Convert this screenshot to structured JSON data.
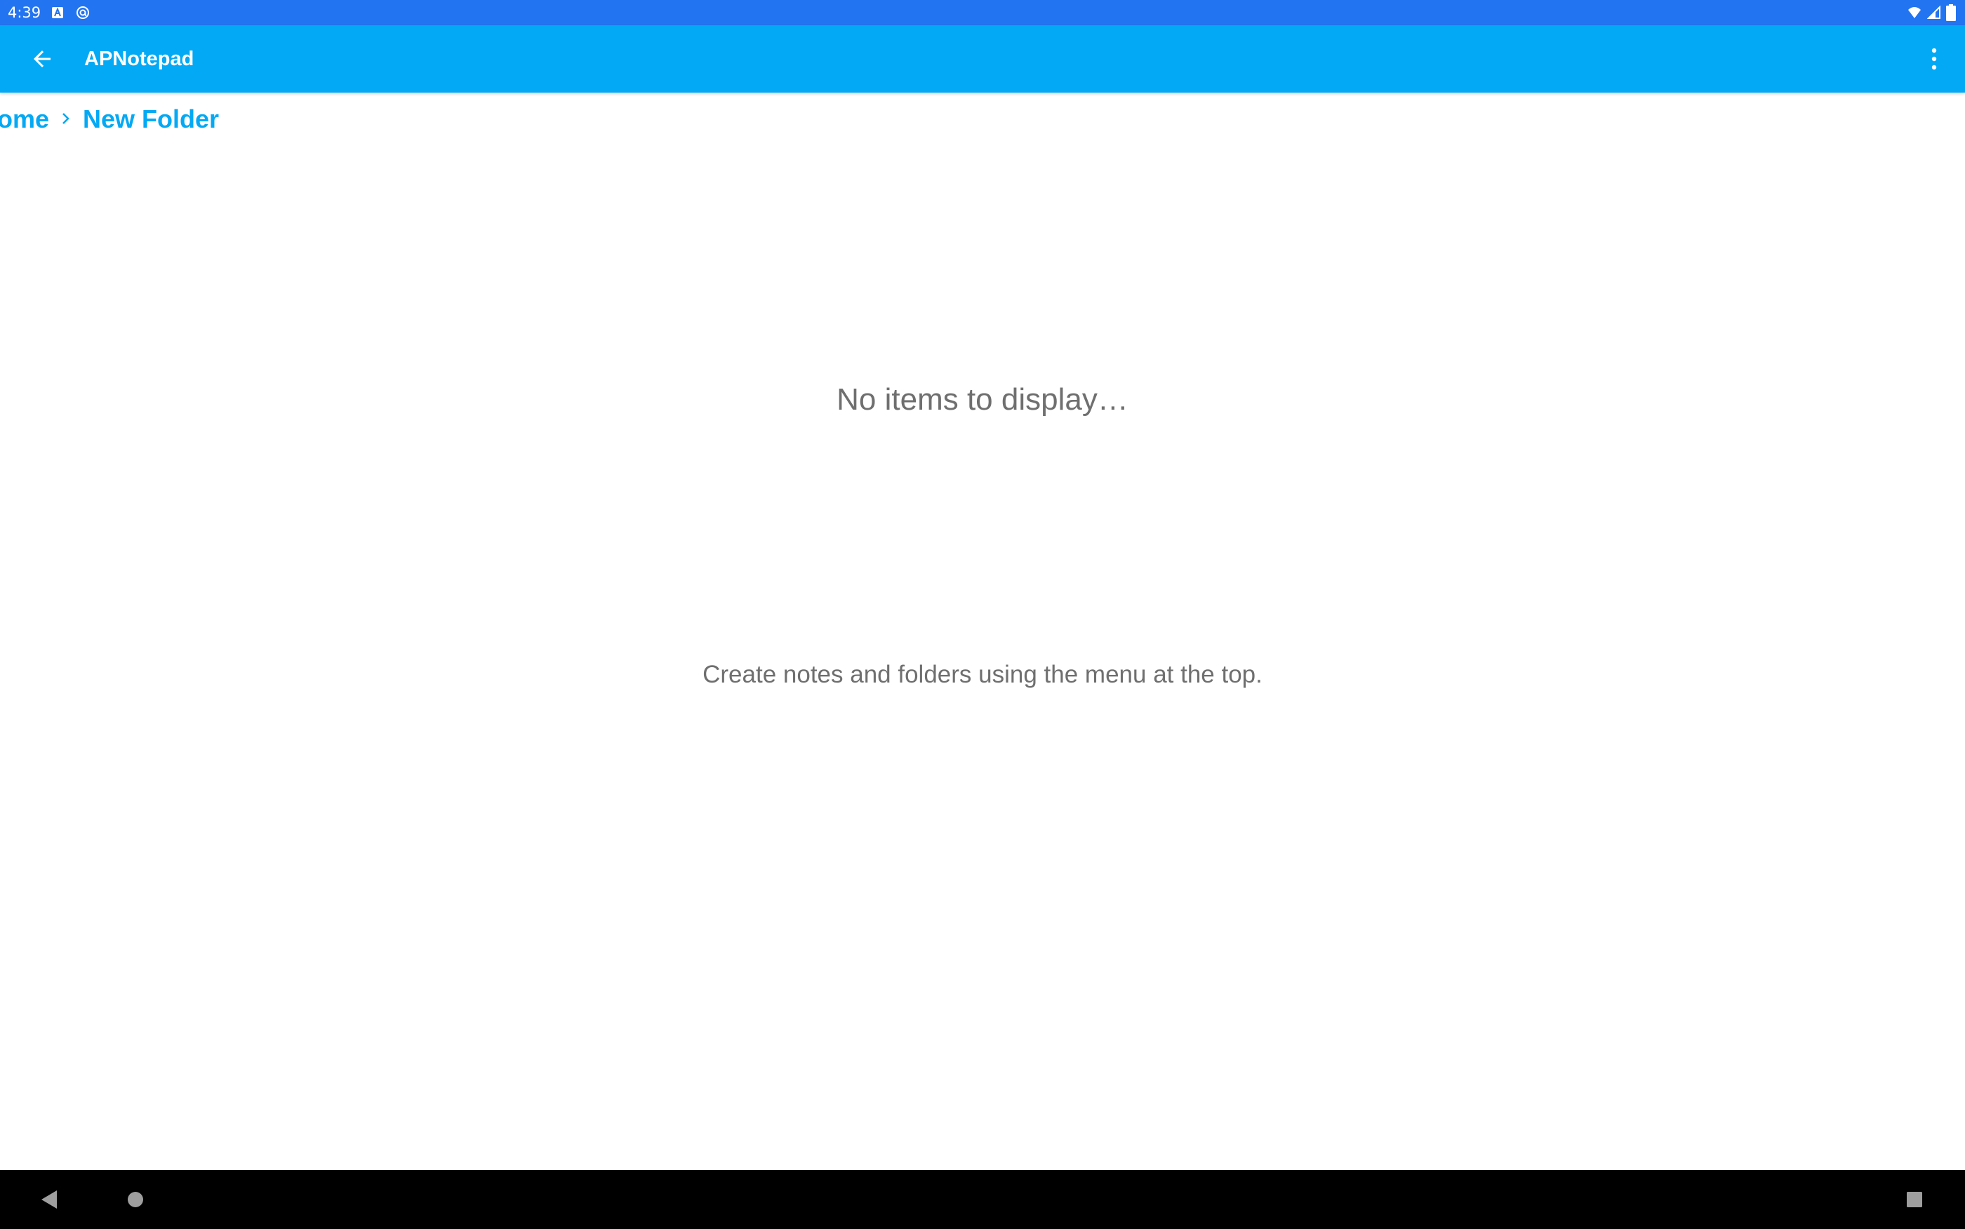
{
  "status_bar": {
    "time": "4:39",
    "icons": [
      "a-notification-icon",
      "at-notification-icon",
      "wifi-icon",
      "cell-signal-icon",
      "battery-icon"
    ]
  },
  "app_bar": {
    "title": "APNotepad",
    "back_icon": "arrow-back-icon",
    "menu_icon": "more-vert-icon",
    "color": "#03a9f4"
  },
  "breadcrumb": {
    "items": [
      {
        "label": "Home",
        "visible_text": "ome"
      },
      {
        "label": "New Folder",
        "visible_text": "New Folder"
      }
    ],
    "separator_icon": "chevron-right-icon",
    "color": "#03a9f4"
  },
  "empty_state": {
    "title": "No items to display…",
    "hint": "Create notes and folders using the menu at the top."
  },
  "nav_bar": {
    "buttons": [
      "back-triangle-icon",
      "home-circle-icon",
      "recents-square-icon"
    ]
  }
}
